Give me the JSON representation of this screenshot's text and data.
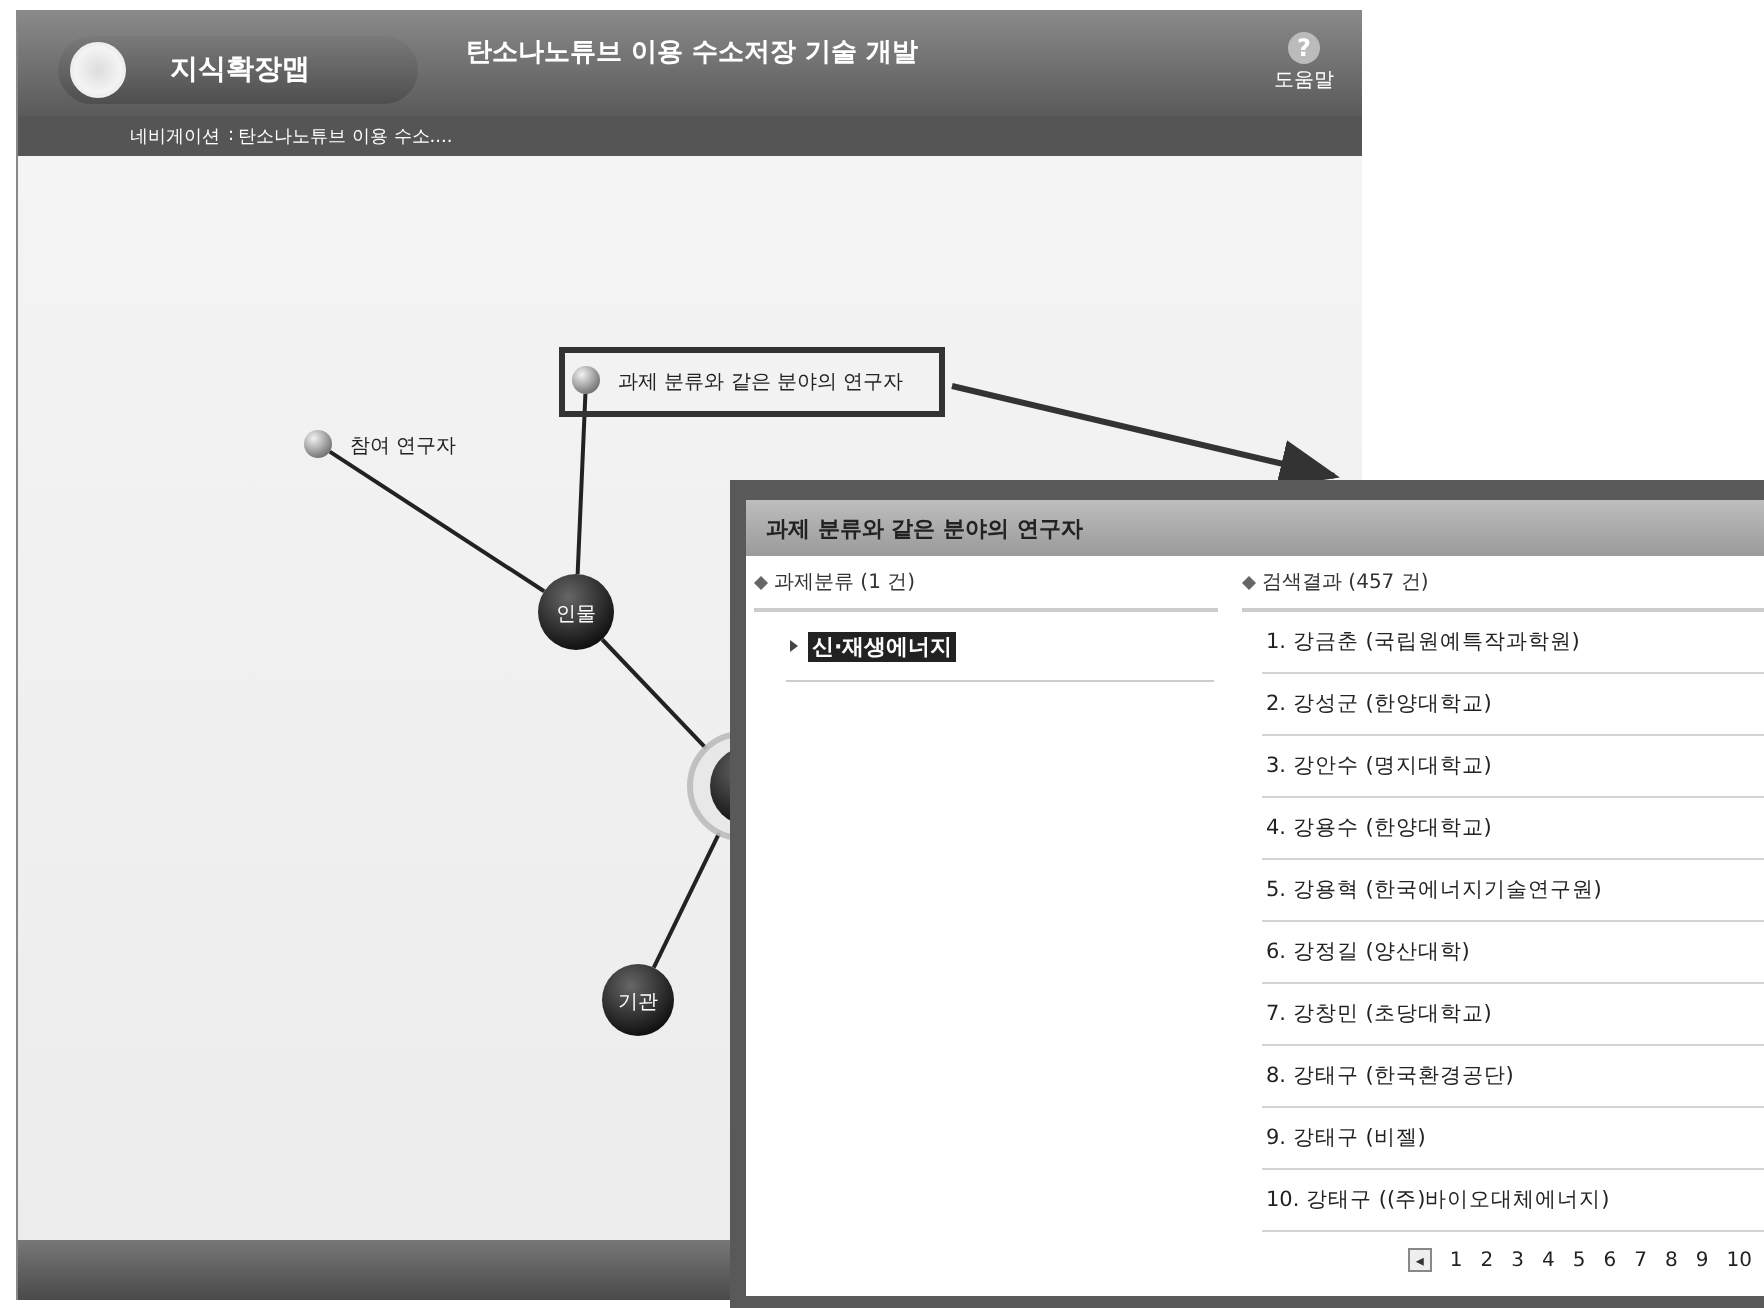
{
  "header": {
    "app_name": "지식확장맵",
    "title": "탄소나노튜브 이용 수소저장 기술 개발",
    "help_icon": "?",
    "help_label": "도움말"
  },
  "navigation": {
    "label": "네비게이션",
    "separator": ":",
    "path": "탄소나노튜브 이용 수소...."
  },
  "map": {
    "nodes": [
      {
        "kind": "leaf",
        "label": "과제 분류와 같은 분야의 연구자",
        "highlighted": true
      },
      {
        "kind": "leaf",
        "label": "참여 연구자",
        "highlighted": false
      },
      {
        "kind": "hub",
        "label": "인물",
        "highlighted": false
      },
      {
        "kind": "center",
        "highlighted": false
      },
      {
        "kind": "hub",
        "label": "기관",
        "highlighted": false
      }
    ]
  },
  "popup": {
    "title": "과제 분류와 같은 분야의 연구자",
    "categories": {
      "heading": "과제분류 (1 건)",
      "items": [
        {
          "label": "신·재생에너지",
          "selected": true
        }
      ]
    },
    "results": {
      "heading": "검색결과 (457 건)",
      "items": [
        "1. 강금춘 (국립원예특작과학원)",
        "2. 강성군 (한양대학교)",
        "3. 강안수 (명지대학교)",
        "4. 강용수 (한양대학교)",
        "5. 강용혁 (한국에너지기술연구원)",
        "6. 강정길 (양산대학)",
        "7. 강창민 (초당대학교)",
        "8. 강태구 (한국환경공단)",
        "9. 강태구 (비젤)",
        "10. 강태구 ((주)바이오대체에너지)"
      ]
    },
    "pagination": {
      "prev_icon": "◂",
      "pages": [
        {
          "label": "1",
          "selected": false
        },
        {
          "label": "2",
          "selected": false
        },
        {
          "label": "3",
          "selected": false
        },
        {
          "label": "4",
          "selected": false
        },
        {
          "label": "5",
          "selected": false
        },
        {
          "label": "6",
          "selected": false
        },
        {
          "label": "7",
          "selected": false
        },
        {
          "label": "8",
          "selected": false
        },
        {
          "label": "9",
          "selected": false
        },
        {
          "label": "10",
          "selected": false
        }
      ]
    }
  }
}
